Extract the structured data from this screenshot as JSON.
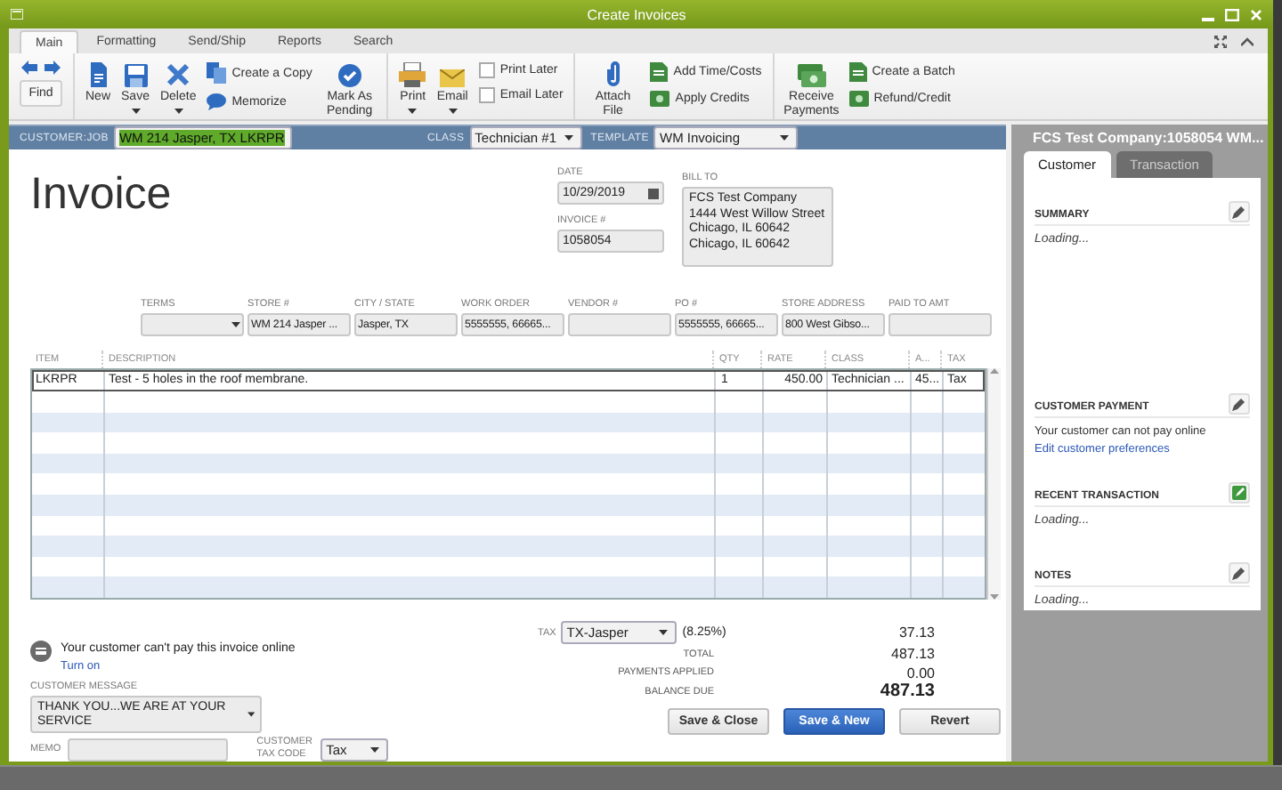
{
  "window": {
    "title": "Create Invoices"
  },
  "ribbon_tabs": [
    {
      "label": "Main",
      "selected": true
    },
    {
      "label": "Formatting",
      "selected": false
    },
    {
      "label": "Send/Ship",
      "selected": false
    },
    {
      "label": "Reports",
      "selected": false
    },
    {
      "label": "Search",
      "selected": false
    }
  ],
  "toolbar": [
    {
      "items": [
        {
          "kind": "find",
          "label": "Find"
        }
      ]
    },
    {
      "items": [
        {
          "kind": "big",
          "label": "New",
          "caret": false
        },
        {
          "kind": "big",
          "label": "Save",
          "caret": true
        },
        {
          "kind": "big",
          "label": "Delete",
          "caret": true
        },
        {
          "kind": "stack",
          "entries": [
            {
              "kind": "small",
              "label": "Create a Copy"
            },
            {
              "kind": "small",
              "label": "Memorize"
            }
          ]
        },
        {
          "kind": "big",
          "label": "Mark As Pending",
          "caret": false
        }
      ]
    },
    {
      "items": [
        {
          "kind": "big",
          "label": "Print",
          "caret": true
        },
        {
          "kind": "big",
          "label": "Email",
          "caret": true
        },
        {
          "kind": "stack",
          "entries": [
            {
              "kind": "check",
              "label": "Print Later",
              "checked": false
            },
            {
              "kind": "check",
              "label": "Email Later",
              "checked": false
            }
          ]
        }
      ]
    },
    {
      "items": [
        {
          "kind": "big",
          "label": "Attach File",
          "caret": false
        },
        {
          "kind": "stack",
          "entries": [
            {
              "kind": "small",
              "label": "Add Time/Costs"
            },
            {
              "kind": "small",
              "label": "Apply Credits"
            }
          ]
        }
      ]
    },
    {
      "items": [
        {
          "kind": "big",
          "label": "Receive Payments",
          "caret": false
        },
        {
          "kind": "stack",
          "entries": [
            {
              "kind": "small",
              "label": "Create a Batch"
            },
            {
              "kind": "small",
              "label": "Refund/Credit"
            }
          ]
        }
      ]
    }
  ],
  "header": {
    "customer_job": {
      "label": "CUSTOMER:JOB",
      "value": "WM 214 Jasper, TX LKRPR",
      "text_selected": true
    },
    "class": {
      "label": "CLASS",
      "value": "Technician #1"
    },
    "template": {
      "label": "TEMPLATE",
      "value": "WM Invoicing"
    }
  },
  "invoice": {
    "title": "Invoice",
    "date": {
      "label": "DATE",
      "value": "10/29/2019"
    },
    "number": {
      "label": "INVOICE #",
      "value": "1058054"
    },
    "bill_to": {
      "label": "BILL TO",
      "lines": [
        "FCS Test Company",
        "1444 West Willow Street",
        "Chicago, IL 60642",
        "Chicago, IL 60642"
      ]
    },
    "fields": [
      {
        "label": "TERMS",
        "kind": "dropdown"
      },
      {
        "label": "STORE #",
        "value": "WM 214 Jasper ...",
        "kind": "text"
      },
      {
        "label": "CITY / STATE",
        "value": "Jasper, TX",
        "kind": "text"
      },
      {
        "label": "WORK ORDER",
        "value": "5555555, 66665...",
        "kind": "text"
      },
      {
        "label": "VENDOR #",
        "kind": "text"
      },
      {
        "label": "PO #",
        "value": "5555555, 66665...",
        "kind": "text"
      },
      {
        "label": "STORE ADDRESS",
        "value": "800 West Gibso...",
        "kind": "text"
      },
      {
        "label": "PAID TO AMT",
        "kind": "text"
      }
    ]
  },
  "table": {
    "columns": [
      "ITEM",
      "DESCRIPTION",
      "QTY",
      "RATE",
      "CLASS",
      "A...",
      "TAX"
    ],
    "rows": [
      {
        "cells": [
          "LKRPR",
          "Test - 5 holes in the roof membrane.",
          "1",
          "450.00",
          "Technician ...",
          "45...",
          "Tax"
        ],
        "selected": true
      }
    ]
  },
  "online_payment": {
    "message": "Your customer can't pay this invoice online",
    "link": "Turn on"
  },
  "customer_message": {
    "label": "CUSTOMER MESSAGE",
    "value": "THANK YOU...WE ARE AT YOUR SERVICE"
  },
  "memo": {
    "label": "MEMO"
  },
  "customer_tax_code": {
    "label": "CUSTOMER TAX CODE",
    "value": "Tax"
  },
  "tax": {
    "label": "TAX",
    "value": "TX-Jasper",
    "rate": "(8.25%)",
    "amount": "37.13"
  },
  "totals": [
    {
      "label": "TOTAL",
      "value": "487.13",
      "kind": "normal"
    },
    {
      "label": "PAYMENTS APPLIED",
      "value": "0.00",
      "kind": "normal"
    },
    {
      "label": "BALANCE DUE",
      "value": "487.13",
      "kind": "emphasis"
    }
  ],
  "buttons": [
    {
      "label": "Save & Close",
      "kind": "default"
    },
    {
      "label": "Save & New",
      "kind": "primary"
    },
    {
      "label": "Revert",
      "kind": "default"
    }
  ],
  "panel": {
    "title": "FCS Test Company:1058054 WM...",
    "tabs": [
      {
        "label": "Customer",
        "selected": true
      },
      {
        "label": "Transaction",
        "selected": false
      }
    ],
    "sections": [
      {
        "heading": "SUMMARY",
        "kind": "edit",
        "lines": [
          {
            "kind": "loading",
            "text": "Loading..."
          }
        ]
      },
      {
        "heading": "CUSTOMER PAYMENT",
        "kind": "edit",
        "lines": [
          {
            "kind": "text",
            "text": "Your customer can not pay online"
          },
          {
            "kind": "link",
            "text": "Edit customer preferences"
          }
        ]
      },
      {
        "heading": "RECENT TRANSACTION",
        "kind": "add",
        "lines": [
          {
            "kind": "loading",
            "text": "Loading..."
          }
        ]
      },
      {
        "heading": "NOTES",
        "kind": "edit",
        "lines": [
          {
            "kind": "loading",
            "text": "Loading..."
          }
        ]
      }
    ]
  }
}
